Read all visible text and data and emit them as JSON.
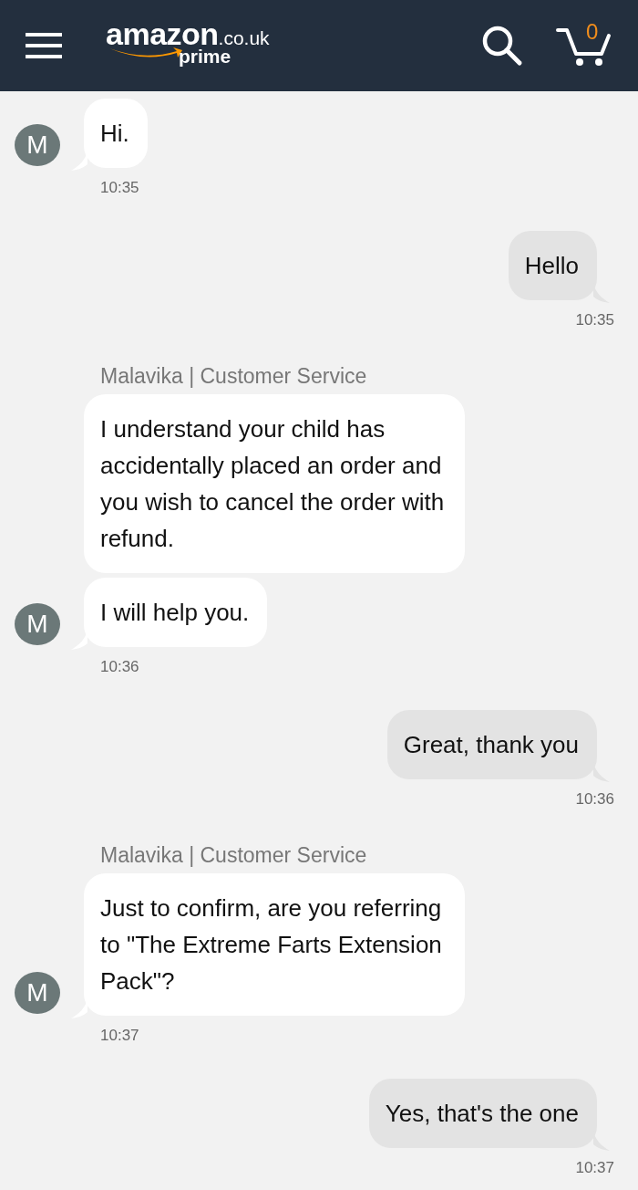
{
  "header": {
    "logo": {
      "brand": "amazon",
      "domain": ".co.uk",
      "tier": "prime"
    },
    "cart_count": "0"
  },
  "messages": [
    {
      "kind": "agent",
      "avatar": "M",
      "bubbles": [
        "Hi."
      ],
      "time": "10:35"
    },
    {
      "kind": "user",
      "bubbles": [
        "Hello"
      ],
      "time": "10:35"
    },
    {
      "kind": "agent",
      "sender": "Malavika | Customer Service",
      "avatar": "M",
      "bubbles": [
        "I understand your child has accidentally placed an order and you wish to cancel the order with refund.",
        "I will help you."
      ],
      "time": "10:36"
    },
    {
      "kind": "user",
      "bubbles": [
        "Great, thank you"
      ],
      "time": "10:36"
    },
    {
      "kind": "agent",
      "sender": "Malavika | Customer Service",
      "avatar": "M",
      "bubbles": [
        "Just to confirm, are you referring to \"The Extreme Farts Extension Pack\"?"
      ],
      "time": "10:37"
    },
    {
      "kind": "user",
      "bubbles": [
        "Yes, that's the one"
      ],
      "time": "10:37"
    }
  ]
}
